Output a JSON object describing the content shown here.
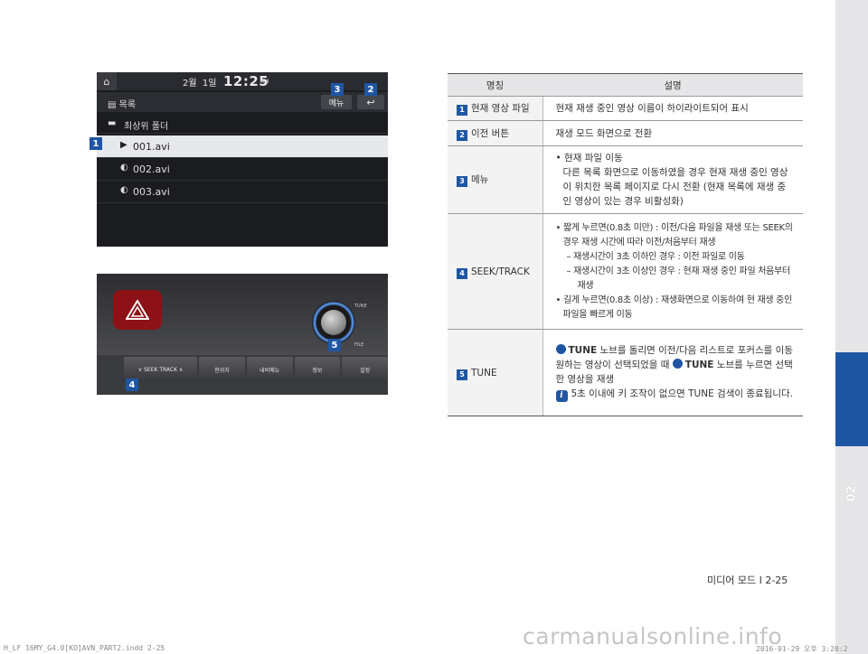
{
  "side_tab": {
    "chapter": "02"
  },
  "screen": {
    "status": {
      "date_month": "2월",
      "date_day": "1일",
      "time": "12:25",
      "ampm": "AM"
    },
    "list_title": "목록",
    "menu_label": "메뉴",
    "back_symbol": "↩",
    "folder": "최상위 폴더",
    "files": [
      "001.avi",
      "002.avi",
      "003.avi"
    ]
  },
  "callouts": {
    "c1": "1",
    "c2": "2",
    "c3": "3",
    "c4": "4",
    "c5": "5"
  },
  "console": {
    "tune_label": "TUNE",
    "file_label": "FILE",
    "seek_label": "SEEK TRACK",
    "buttons": [
      "현위치",
      "내비메뉴",
      "정보",
      "설정"
    ]
  },
  "table": {
    "header_name": "명칭",
    "header_desc": "설명",
    "rows": [
      {
        "num": "1",
        "name": "현재 영상 파일",
        "desc": "현재 재생 중인 영상 이름이 하이라이트되어 표시"
      },
      {
        "num": "2",
        "name": "이전 버튼",
        "desc": "재생 모드 화면으로 전환"
      },
      {
        "num": "3",
        "name": "메뉴",
        "bullet": "• 현재 파일 이동",
        "lines": "다른 목록 화면으로 이동하였을 경우 현재 재생 중인 영상이 위치한 목록 페이지로 다시 전환 (현재 목록에 재생 중인 영상이 있는 경우 비활성화)"
      },
      {
        "num": "4",
        "name": "SEEK/TRACK",
        "b1": "• 짧게 누르면(0.8초 미만) : 이전/다음 파일을 재생 또는 SEEK의 경우 재생 시간에 따라 이전/처음부터 재생",
        "d1": "– 재생시간이 3초 이하인 경우 : 이전 파일로 이동",
        "d2": "– 재생시간이 3초 이상인 경우 : 현재 재생 중인 파일 처음부터 재생",
        "b2": "• 길게 누르면(0.8초 이상) : 재생화면으로 이동하여 현 재생 중인 파일을 빠르게 이동"
      },
      {
        "num": "5",
        "name": "TUNE",
        "p1a": "TUNE",
        "p1b": " 노브를 돌리면 이전/다음 리스트로 포커스를 이동 원하는 영상이 선택되었을 때 ",
        "p1c": "TUNE",
        "p1d": " 노브를 누르면 선택한 영상을 재생",
        "info_icon": "i",
        "note": "5초 이내에 키 조작이 없으면 TUNE 검색이 종료됩니다."
      }
    ]
  },
  "footer": {
    "page": "미디어 모드 I 2-25",
    "print_left": "H_LF 16MY_G4.0[KO]AVN_PART2.indd   2-25",
    "print_right": "2016-01-29   오후 3:20:2",
    "watermark": "carmanualsonline.info"
  }
}
